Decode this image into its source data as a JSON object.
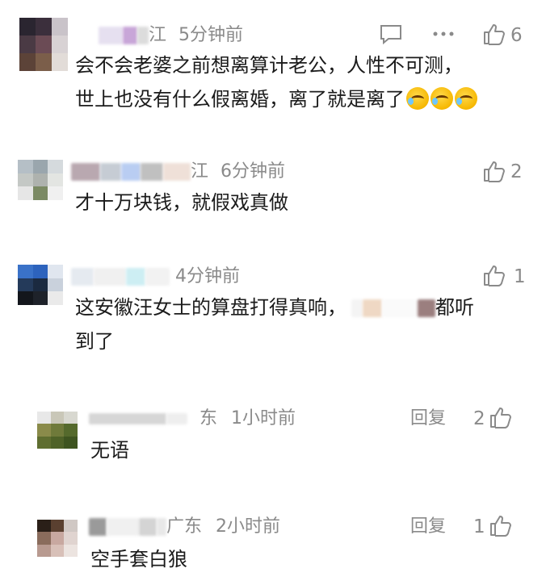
{
  "comments": [
    {
      "user_suffix": "江",
      "time": "5分钟前",
      "likes": "6",
      "text_lines": [
        "会不会老婆之前想离算计老公，人性不可测，",
        "世上也没有什么假离婚，离了就是离了"
      ],
      "emoji": "crying-laughing-emoji"
    },
    {
      "user_suffix": "江",
      "time": "6分钟前",
      "likes": "2",
      "text_lines": [
        "才十万块钱，就假戏真做"
      ]
    },
    {
      "user_suffix": "",
      "time": "4分钟前",
      "likes": "1",
      "text_line1_prefix": "这安徽汪女士的算盘打得真响，",
      "text_line1_suffix": "都听",
      "text_line2": "到了"
    }
  ],
  "replies": [
    {
      "user_fragment": "东",
      "time": "1小时前",
      "reply_label": "回复",
      "likes": "2",
      "text": "无语"
    },
    {
      "user_fragment": "广东",
      "time": "2小时前",
      "reply_label": "回复",
      "likes": "1",
      "text": "空手套白狼"
    }
  ],
  "colors": {
    "meta_gray": "#8a8a8a",
    "text_dark": "#1b1b1b"
  },
  "icons": [
    "comment-icon",
    "more-icon",
    "thumbs-up-icon",
    "crying-laughing-emoji"
  ]
}
